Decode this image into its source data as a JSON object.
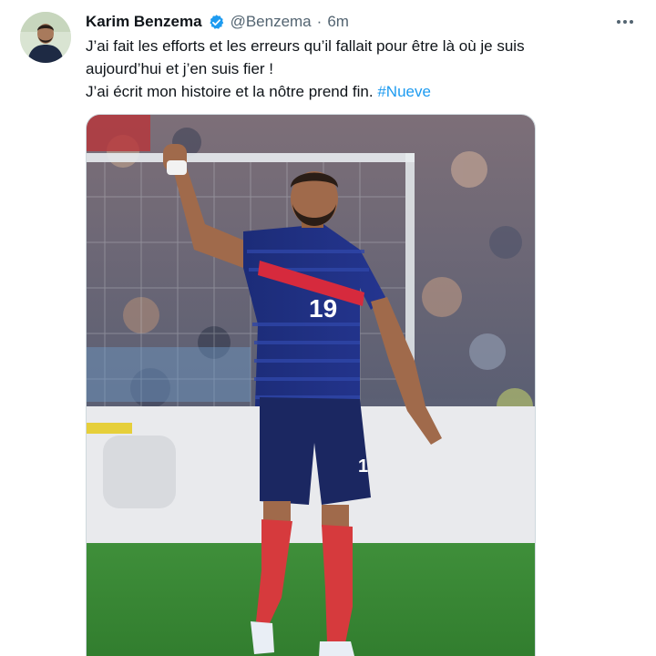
{
  "tweet": {
    "author": {
      "display_name": "Karim Benzema",
      "handle": "@Benzema",
      "verified": true,
      "avatar_icon": "profile-photo"
    },
    "separator": "·",
    "time": "6m",
    "more_icon": "more-horizontal-icon",
    "text": {
      "line1": "J’ai fait les efforts et les erreurs qu’il fallait pour être là où je suis",
      "line2": "aujourd’hui et j’en suis fier !",
      "line3": "J’ai écrit mon histoire et la nôtre prend fin.",
      "hashtag": "#Nueve"
    },
    "media": {
      "shirt_number": "19"
    }
  },
  "colors": {
    "accent": "#1d9bf0",
    "text": "#0f1419",
    "muted": "#536471"
  }
}
